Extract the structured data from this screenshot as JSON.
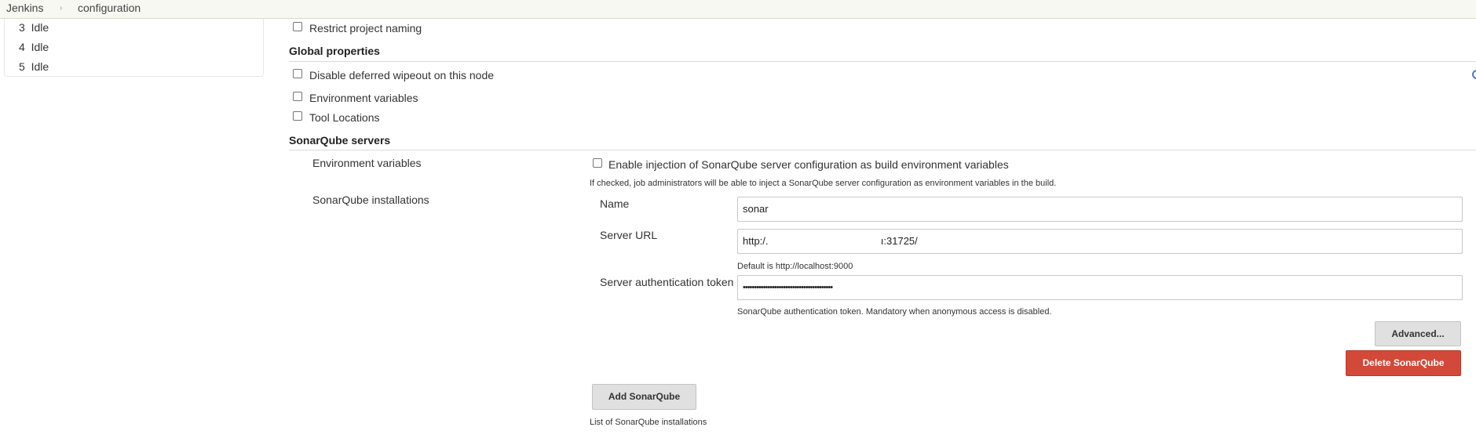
{
  "breadcrumb": {
    "items": [
      "Jenkins",
      "configuration"
    ]
  },
  "executors": [
    {
      "number": "3",
      "status": "Idle"
    },
    {
      "number": "4",
      "status": "Idle"
    },
    {
      "number": "5",
      "status": "Idle"
    }
  ],
  "options": {
    "restrict_naming": "Restrict project naming"
  },
  "global_properties": {
    "title": "Global properties",
    "disable_wipeout": "Disable deferred wipeout on this node",
    "env_vars": "Environment variables",
    "tool_locations": "Tool Locations"
  },
  "sonar": {
    "title": "SonarQube servers",
    "env_label": "Environment variables",
    "env_checkbox_label": "Enable injection of SonarQube server configuration as build environment variables",
    "env_help": "If checked, job administrators will be able to inject a SonarQube server configuration as environment variables in the build.",
    "installations_label": "SonarQube installations",
    "name_label": "Name",
    "name_value": "sonar",
    "url_label": "Server URL",
    "url_value_start": "http:/.",
    "url_value_end": "ı:31725/",
    "url_help": "Default is http://localhost:9000",
    "token_label": "Server authentication token",
    "token_value": "••••••••••••••••••••••••••••••••••••••••",
    "token_help": "SonarQube authentication token. Mandatory when anonymous access is disabled.",
    "advanced_button": "Advanced...",
    "delete_button": "Delete SonarQube",
    "add_button": "Add SonarQube",
    "list_help": "List of SonarQube installations"
  },
  "colors": {
    "breadcrumb_bg": "#f7f8f2",
    "delete_red": "#d24939",
    "help_blue": "#4a7bd0"
  }
}
